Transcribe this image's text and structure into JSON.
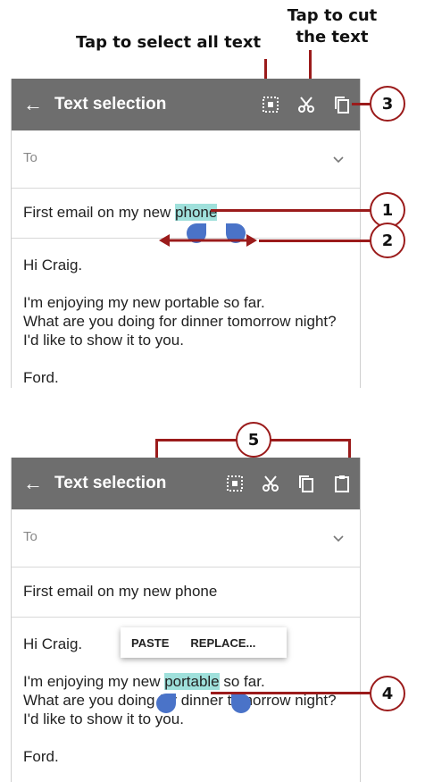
{
  "callouts": {
    "select_all": "Tap to select all text",
    "cut_line1": "Tap to cut",
    "cut_line2": "the text"
  },
  "appbar": {
    "title": "Text selection",
    "back_icon": "arrow-left-icon"
  },
  "email": {
    "to_label": "To",
    "subject_before": "First email on my new ",
    "subject_selected": "phone",
    "subject_full": "First email on my new phone",
    "greeting": "Hi Craig.",
    "line1_before": "I'm enjoying my new ",
    "line1_selected": "portable",
    "line1_after": " so far.",
    "line2": "What are you doing for dinner tomorrow night?",
    "line3": "I'd like to show it to you.",
    "sign": "Ford."
  },
  "context_menu": {
    "paste": "PASTE",
    "replace": "REPLACE..."
  },
  "markers": [
    "1",
    "2",
    "3",
    "4",
    "5"
  ],
  "colors": {
    "appbar": "#6e6e6e",
    "selection": "#9fe0db",
    "handle": "#4a73c8",
    "callout": "#9b1b1b"
  }
}
